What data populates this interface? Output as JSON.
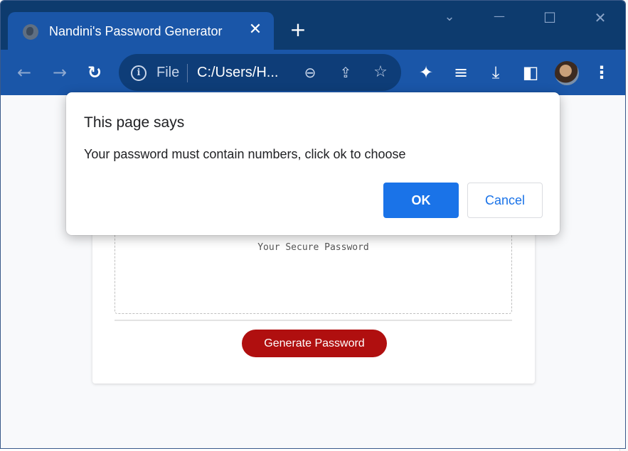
{
  "browser": {
    "tab": {
      "title": "Nandini's Password Generator",
      "favicon": "globe-icon",
      "close_glyph": "✕"
    },
    "new_tab_glyph": "+",
    "window_controls": {
      "minimize_glyph": "—",
      "maximize_glyph": "☐",
      "close_glyph": "✕",
      "tab_search_glyph": "⌄"
    },
    "toolbar": {
      "back_glyph": "←",
      "forward_glyph": "→",
      "reload_glyph": "↻",
      "omnibox": {
        "info_glyph": "i",
        "scheme_label": "File",
        "url": "C:/Users/H...",
        "zoom_glyph": "⊖",
        "share_glyph": "⇪",
        "bookmark_glyph": "☆"
      },
      "extensions_glyph": "✦",
      "media_glyph": "≡",
      "download_glyph": "⤓",
      "sidepanel_glyph": "◧",
      "menu_glyph": "⋮"
    }
  },
  "page": {
    "password_placeholder": "Your Secure Password",
    "generate_button": "Generate Password"
  },
  "dialog": {
    "heading": "This page says",
    "message": "Your password must contain numbers, click ok to choose",
    "ok_label": "OK",
    "cancel_label": "Cancel"
  },
  "colors": {
    "title_bar": "#0d3b6e",
    "toolbar": "#1a56a8",
    "generate_button": "#b00f0f",
    "ok_button": "#1a73e8"
  }
}
